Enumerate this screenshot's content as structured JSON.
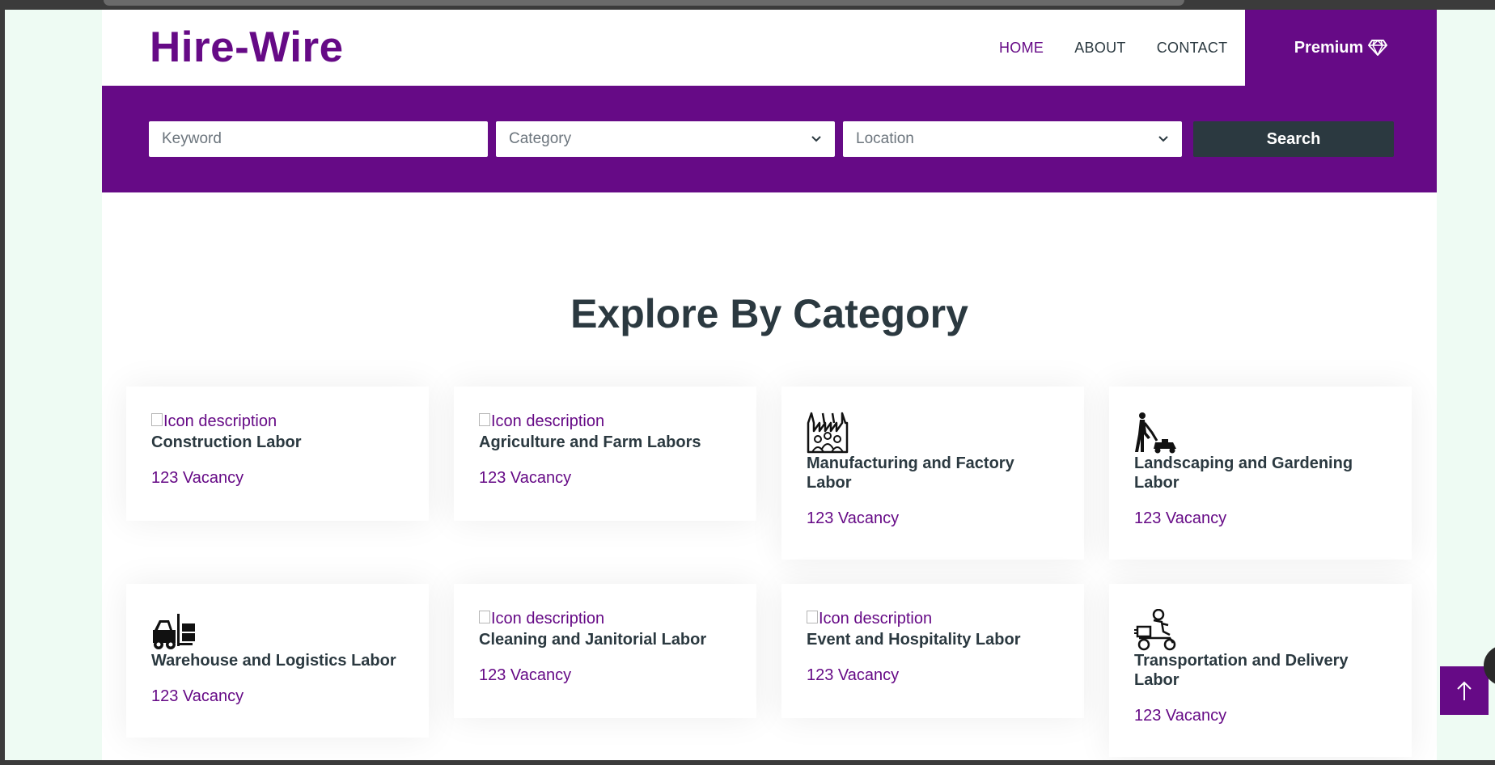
{
  "brand": {
    "name": "Hire-Wire"
  },
  "nav": {
    "items": [
      {
        "label": "HOME",
        "active": true
      },
      {
        "label": "ABOUT",
        "active": false
      },
      {
        "label": "CONTACT",
        "active": false
      }
    ],
    "premium_label": "Premium",
    "premium_icon": "diamond-icon"
  },
  "search": {
    "keyword_placeholder": "Keyword",
    "category_label": "Category",
    "location_label": "Location",
    "button_label": "Search"
  },
  "section": {
    "title": "Explore By Category"
  },
  "categories": [
    {
      "title": "Construction Labor",
      "vacancy": "123 Vacancy",
      "icon_alt": "Icon description",
      "icon": "broken-image"
    },
    {
      "title": "Agriculture and Farm Labors",
      "vacancy": "123 Vacancy",
      "icon_alt": "Icon description",
      "icon": "broken-image"
    },
    {
      "title": "Manufacturing and Factory Labor",
      "vacancy": "123 Vacancy",
      "icon": "factory-workers-icon"
    },
    {
      "title": "Landscaping and Gardening Labor",
      "vacancy": "123 Vacancy",
      "icon": "lawn-mower-icon"
    },
    {
      "title": "Warehouse and Logistics Labor",
      "vacancy": "123 Vacancy",
      "icon": "forklift-icon"
    },
    {
      "title": "Cleaning and Janitorial Labor",
      "vacancy": "123 Vacancy",
      "icon_alt": "Icon description",
      "icon": "broken-image"
    },
    {
      "title": "Event and Hospitality Labor",
      "vacancy": "123 Vacancy",
      "icon_alt": "Icon description",
      "icon": "broken-image"
    },
    {
      "title": "Transportation and Delivery Labor",
      "vacancy": "123 Vacancy",
      "icon": "delivery-scooter-icon"
    }
  ],
  "colors": {
    "brand_purple": "#660a86",
    "dark_slate": "#2b3940",
    "page_background": "#eefbf3"
  }
}
